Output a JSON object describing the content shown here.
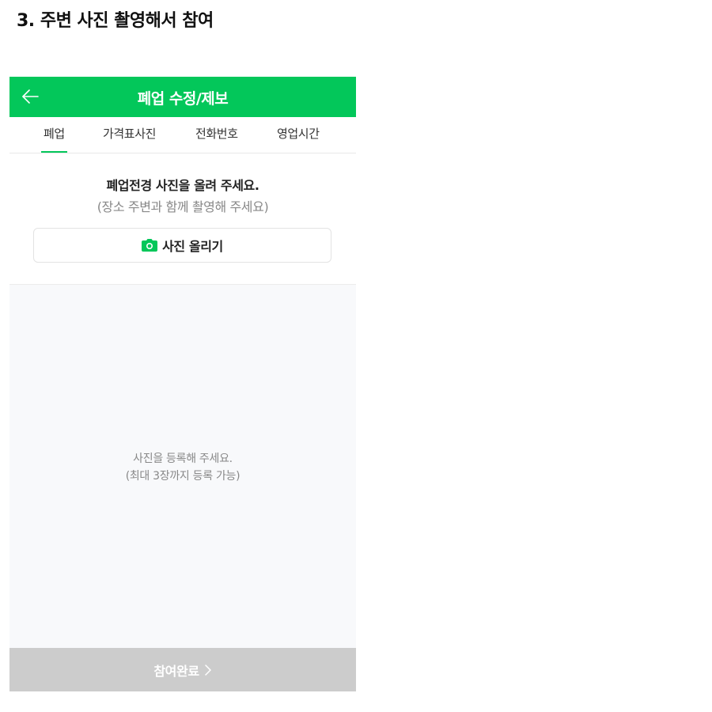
{
  "step_heading": "3. 주변 사진 촬영해서 참여",
  "header": {
    "title": "폐업 수정/제보",
    "back_icon": "arrow-left-icon",
    "background_color": "#03c75a"
  },
  "tabs": [
    {
      "label": "폐업",
      "active": true
    },
    {
      "label": "가격표사진",
      "active": false
    },
    {
      "label": "전화번호",
      "active": false
    },
    {
      "label": "영업시간",
      "active": false
    }
  ],
  "upload": {
    "title": "폐업전경 사진을 올려 주세요.",
    "subtitle": "(장소 주변과 함께 촬영해 주세요)",
    "button_label": "사진 올리기",
    "button_icon": "camera-icon",
    "icon_color": "#03c75a"
  },
  "photo_area": {
    "empty_line1": "사진을 등록해 주세요.",
    "empty_line2": "(최대 3장까지 등록 가능)"
  },
  "submit": {
    "label": "참여완료",
    "icon": "chevron-right-icon",
    "background_color": "#cccccc"
  }
}
